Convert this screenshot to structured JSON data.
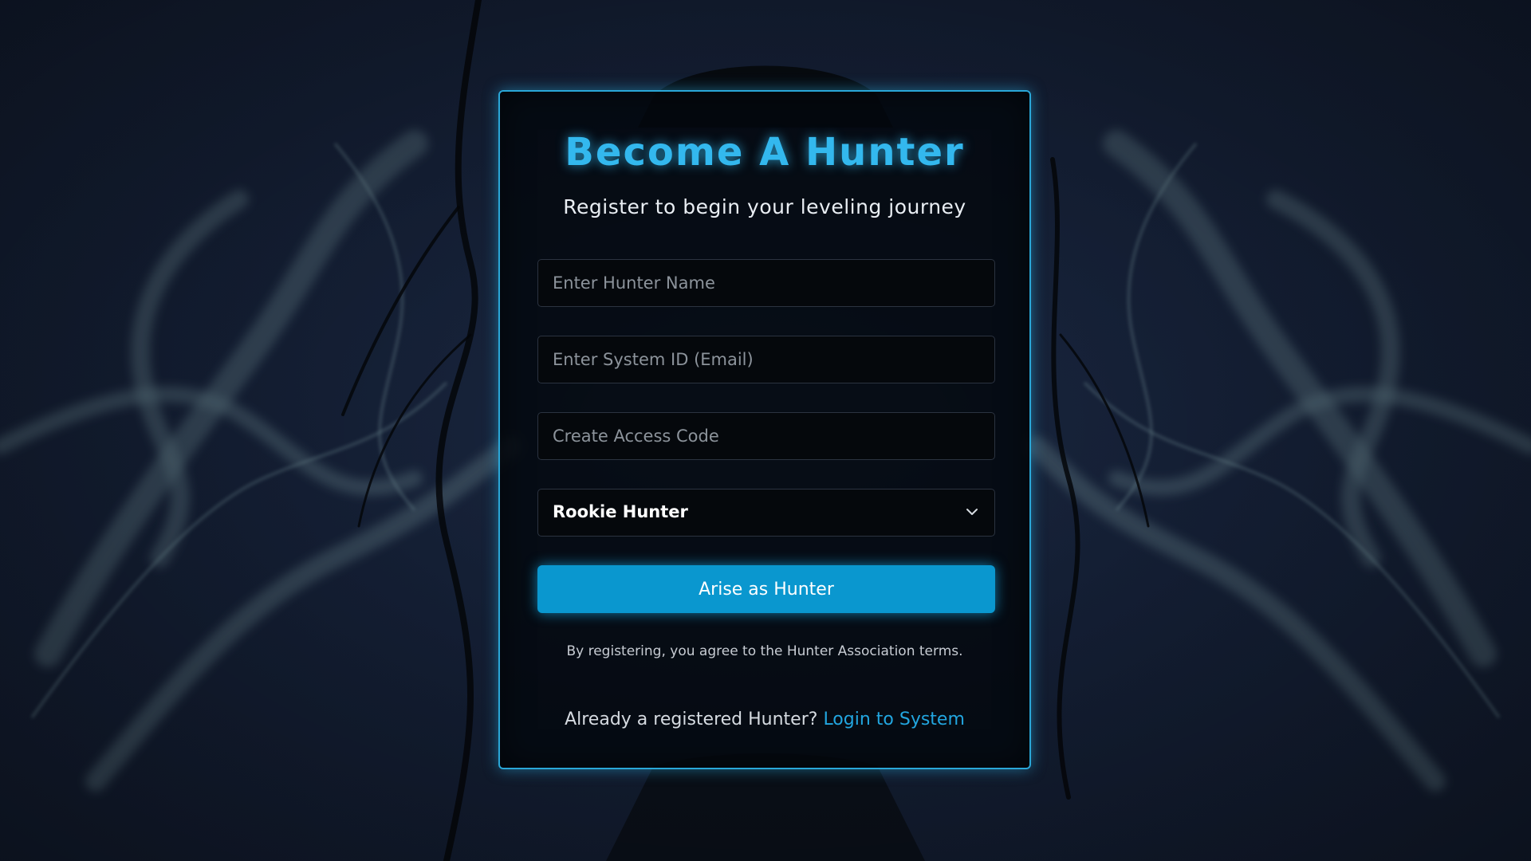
{
  "form": {
    "title": "Become A Hunter",
    "subtitle": "Register to begin your leveling journey",
    "name_placeholder": "Enter Hunter Name",
    "email_placeholder": "Enter System ID (Email)",
    "password_placeholder": "Create Access Code",
    "rank_selected": "Rookie Hunter",
    "submit_label": "Arise as Hunter",
    "terms_text": "By registering, you agree to the Hunter Association terms.",
    "login_prompt": "Already a registered Hunter?",
    "login_link": "Login to System"
  },
  "icons": {
    "dropdown": "chevron-down-icon"
  },
  "colors": {
    "accent": "#33b8ee",
    "button": "#0a97cf",
    "card_border": "#2aa7d8",
    "background": "#16223a"
  }
}
